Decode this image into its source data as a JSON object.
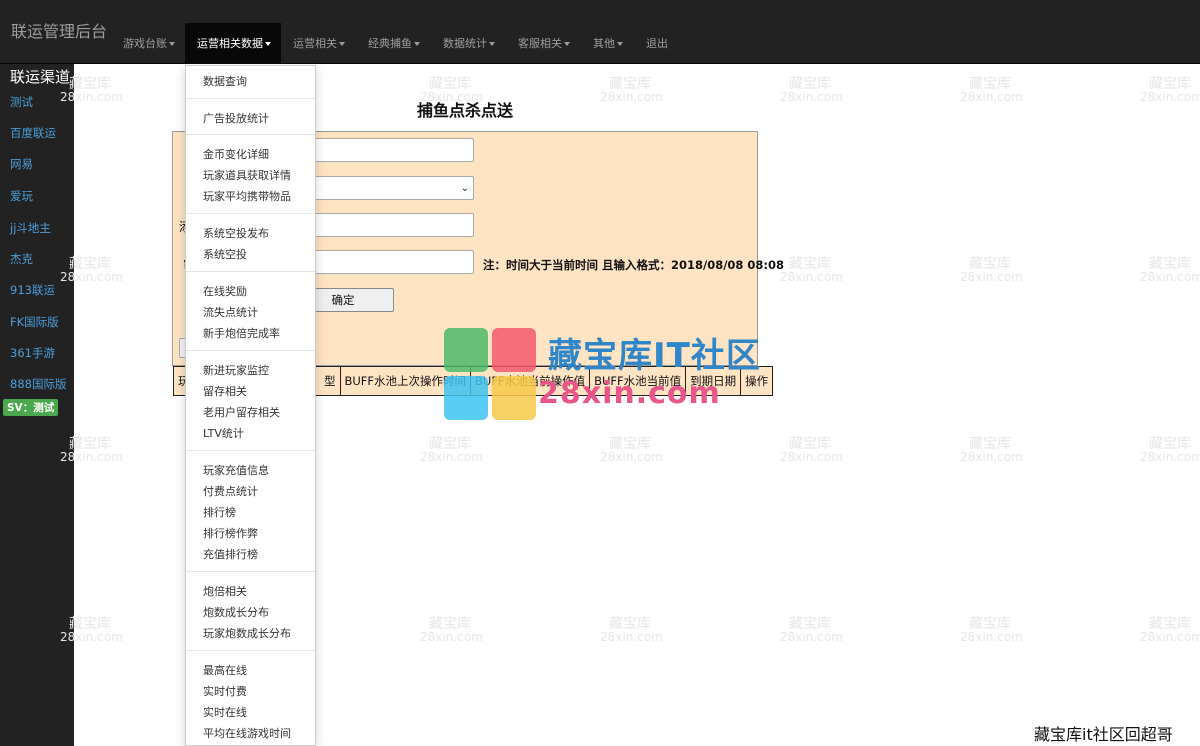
{
  "navbar": {
    "brand": "联运管理后台",
    "items": [
      {
        "label": "游戏台账",
        "caret": true
      },
      {
        "label": "运营相关数据",
        "caret": true,
        "active": true
      },
      {
        "label": "运营相关",
        "caret": true
      },
      {
        "label": "经典捕鱼",
        "caret": true
      },
      {
        "label": "数据统计",
        "caret": true
      },
      {
        "label": "客服相关",
        "caret": true
      },
      {
        "label": "其他",
        "caret": true
      },
      {
        "label": "退出",
        "caret": false
      }
    ]
  },
  "sidebar": {
    "title": "联运渠道",
    "items": [
      "测试",
      "百度联运",
      "网易",
      "爱玩",
      "jj斗地主",
      "杰克",
      "913联运",
      "FK国际版",
      "361手游",
      "888国际版"
    ],
    "badge": "SV：测试"
  },
  "dropdown": {
    "groups": [
      [
        "数据查询"
      ],
      [
        "广告投放统计"
      ],
      [
        "金币变化详细",
        "玩家道具获取详情",
        "玩家平均携带物品"
      ],
      [
        "系统空投发布",
        "系统空投"
      ],
      [
        "在线奖励",
        "流失点统计",
        "新手炮倍完成率"
      ],
      [
        "新进玩家监控",
        "留存相关",
        "老用户留存相关",
        "LTV统计"
      ],
      [
        "玩家充值信息",
        "付费点统计",
        "排行榜",
        "排行榜作弊",
        "充值排行榜"
      ],
      [
        "炮倍相关",
        "炮数成长分布",
        "玩家炮数成长分布"
      ],
      [
        "最高在线",
        "实时付费",
        "实时在线",
        "平均在线游戏时间"
      ]
    ]
  },
  "main": {
    "title": "捕鱼点杀点送",
    "partial_labels": [
      "添",
      "审"
    ],
    "note": "注：时间大于当前时间 且输入格式：2018/08/08 08:08",
    "confirm_button": "确定",
    "table_headers": [
      "玩",
      "型",
      "BUFF水池上次操作时间",
      "BUFF水池当前操作值",
      "BUFF水池当前值",
      "到期日期",
      "操作"
    ]
  },
  "watermark": {
    "cn": "藏宝库",
    "en": "28xin.com"
  },
  "logo": {
    "line1": "藏宝库IT社区",
    "line2": "28xin.com"
  },
  "corner_text": "藏宝库it社区回超哥",
  "colors": {
    "navbar_bg": "#222222",
    "panel_bg": "#ffe4c4",
    "sidebar_link": "#4a9fdc",
    "badge": "#4ba84e"
  }
}
